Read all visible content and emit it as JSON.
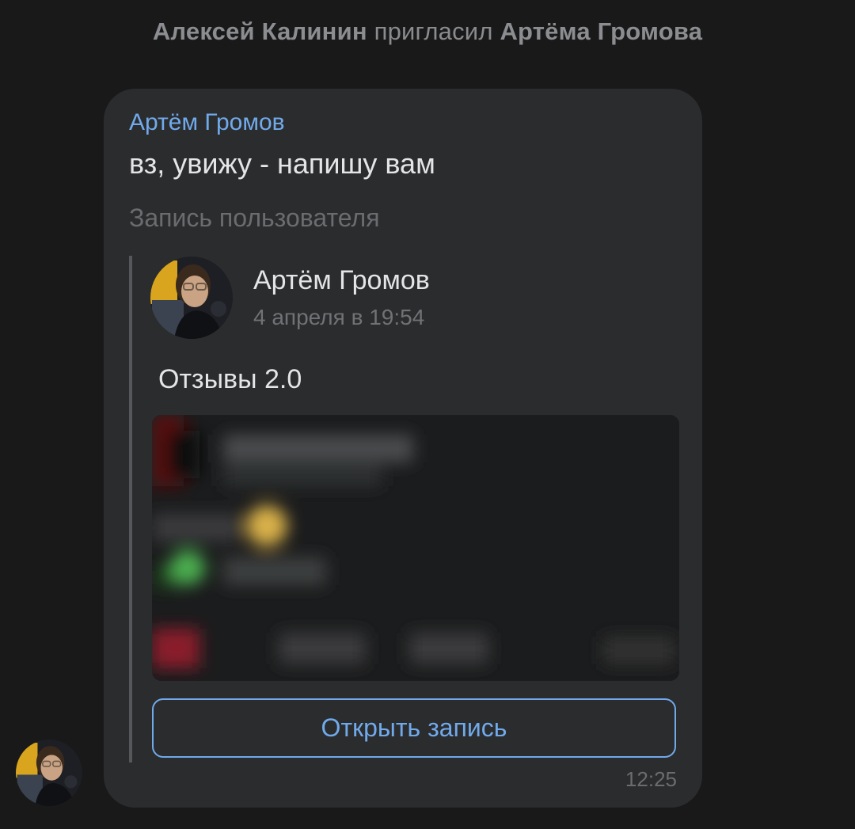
{
  "service_message": {
    "actor": "Алексей Калинин",
    "verb": "пригласил",
    "target": "Артёма Громова"
  },
  "message": {
    "author": "Артём Громов",
    "text": "вз, увижу - напишу вам",
    "time": "12:25",
    "sender_avatar_icon": "user-avatar-photo"
  },
  "repost": {
    "label": "Запись пользователя",
    "author": "Артём Громов",
    "date": "4 апреля в 19:54",
    "text": "Отзывы 2.0",
    "image_icon": "blurred-screenshot-image",
    "open_button_label": "Открыть запись"
  },
  "colors": {
    "background": "#19191a",
    "bubble": "#2b2c2e",
    "accent": "#71aaeb",
    "text_primary": "#e4e5e7",
    "text_secondary": "#6b6c6f"
  }
}
